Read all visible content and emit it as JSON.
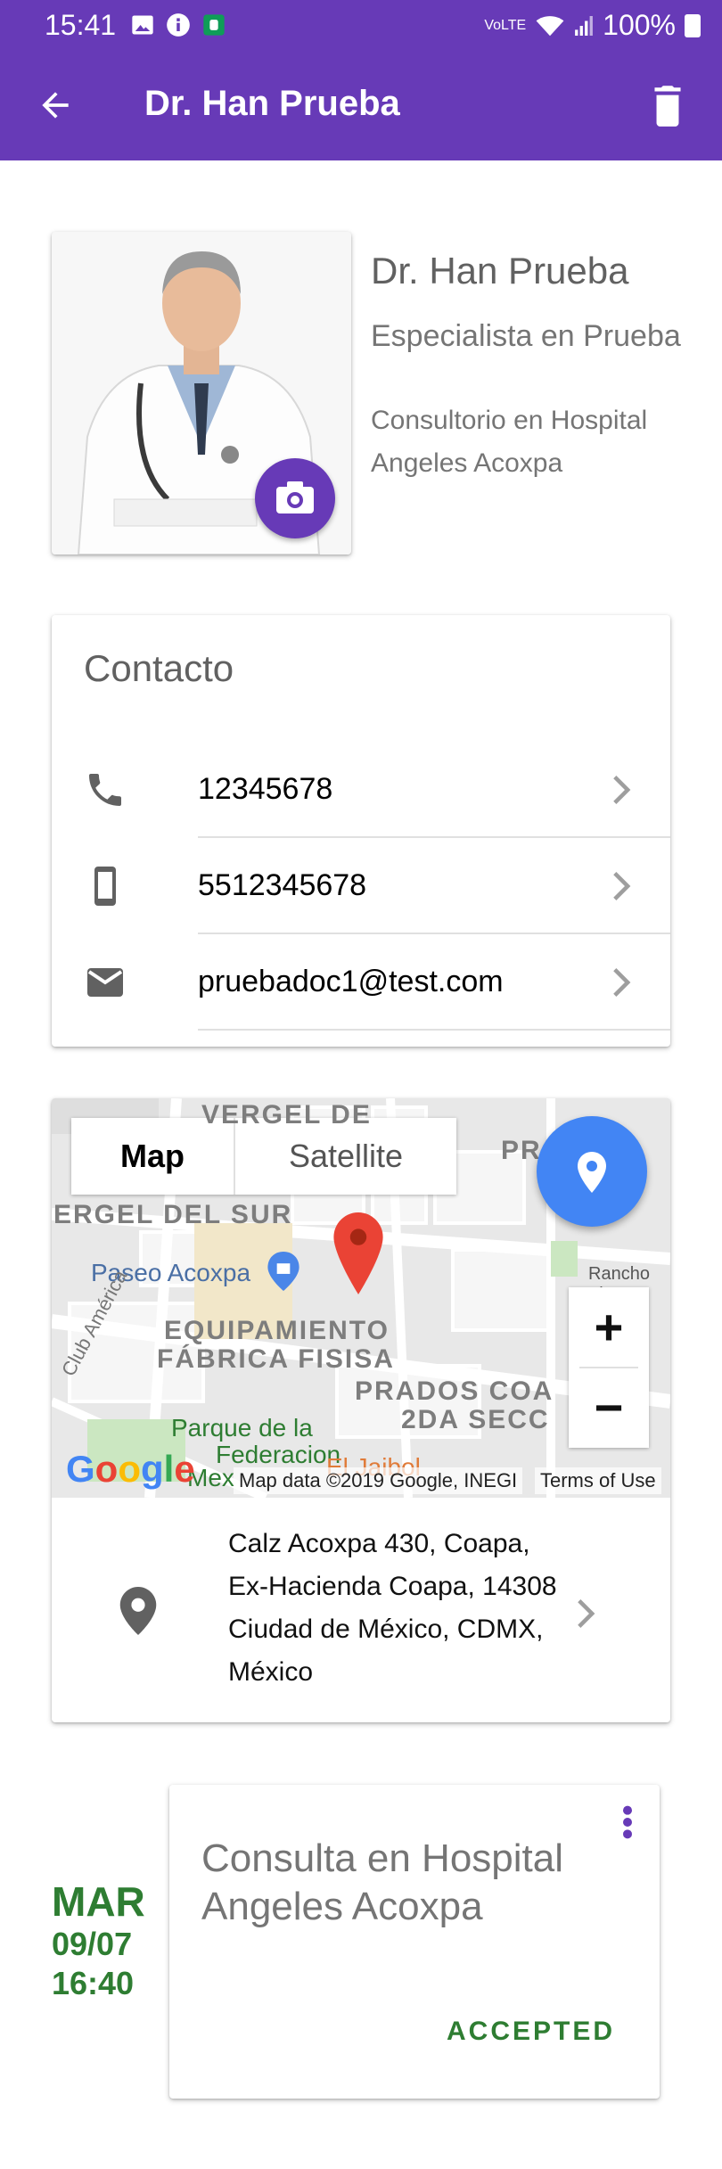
{
  "status_bar": {
    "time": "15:41",
    "battery": "100%",
    "network": "VoLTE"
  },
  "app_bar": {
    "title": "Dr. Han Prueba"
  },
  "profile": {
    "name": "Dr. Han Prueba",
    "specialty": "Especialista en Prueba",
    "office": "Consultorio en Hospital Angeles Acoxpa"
  },
  "contact": {
    "title": "Contacto",
    "items": [
      {
        "icon": "phone-icon",
        "value": "12345678"
      },
      {
        "icon": "mobile-phone-icon",
        "value": "5512345678"
      },
      {
        "icon": "email-icon",
        "value": "pruebadoc1@test.com"
      }
    ]
  },
  "map": {
    "type_map": "Map",
    "type_satellite": "Satellite",
    "zoom_in": "+",
    "zoom_out": "−",
    "labels": {
      "vergel_top": "VERGEL DE",
      "vergel_sur": "ERGEL DEL SUR",
      "paseo": "Paseo Acoxpa",
      "equip1": "EQUIPAMIENTO",
      "equip2": "FÁBRICA FISISA",
      "prados1": "PRADOS COA",
      "prados2": "2DA SECC",
      "club": "Club América",
      "parque1": "Parque de la",
      "parque2": "Federacion",
      "parque3": "Mex",
      "jaibol": "El Jaibol",
      "rancho": "Rancho Tla",
      "pr_c": "PR C",
      "google": "Google"
    },
    "attribution": "Map data ©2019 Google, INEGI",
    "terms": "Terms of Use",
    "address": "Calz Acoxpa 430, Coapa, Ex-Hacienda Coapa, 14308 Ciudad de México, CDMX, México"
  },
  "appointment": {
    "day": "MAR",
    "date": "09/07",
    "time": "16:40",
    "title": "Consulta en Hospital Angeles Acoxpa",
    "status": "ACCEPTED"
  },
  "colors": {
    "primary": "#673ab7",
    "accent_green": "#2e7d32",
    "map_fab": "#4285f4",
    "map_pin": "#ea4335"
  }
}
